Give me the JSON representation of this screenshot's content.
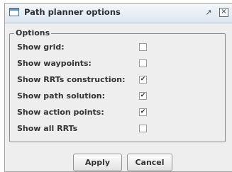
{
  "window": {
    "title": "Path planner options",
    "app_icon": "window-icon",
    "controls": {
      "restore": "restore-icon",
      "close": "close-icon"
    }
  },
  "options_group": {
    "title": "Options",
    "items": [
      {
        "label": "Show grid:",
        "checked": false
      },
      {
        "label": "Show waypoints:",
        "checked": false
      },
      {
        "label": "Show RRTs construction:",
        "checked": true
      },
      {
        "label": "Show path solution:",
        "checked": true
      },
      {
        "label": "Show action points:",
        "checked": true
      },
      {
        "label": "Show all RRTs",
        "checked": false
      }
    ]
  },
  "buttons": {
    "apply": "Apply",
    "cancel": "Cancel"
  },
  "colors": {
    "window_bg": "#eeeeee",
    "titlebar_top": "#f4f7fb",
    "titlebar_bottom": "#dde6f0",
    "border": "#8a8a8a"
  }
}
